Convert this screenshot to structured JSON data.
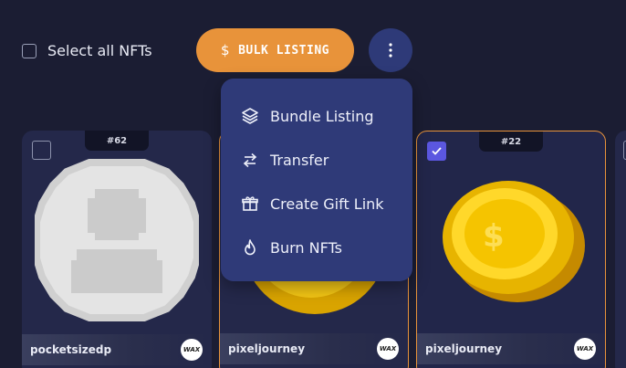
{
  "toolbar": {
    "select_all_label": "Select all NFTs",
    "bulk_listing_label": "BULK LISTING",
    "bulk_listing_icon": "dollar-icon",
    "more_icon": "more-vertical-icon"
  },
  "menu": {
    "items": [
      {
        "label": "Bundle Listing",
        "icon": "layers-icon"
      },
      {
        "label": "Transfer",
        "icon": "transfer-arrows-icon"
      },
      {
        "label": "Create Gift Link",
        "icon": "gift-icon"
      },
      {
        "label": "Burn NFTs",
        "icon": "flame-icon"
      }
    ]
  },
  "cards": [
    {
      "tag": "#62",
      "owner": "pocketsizedp",
      "selected": false,
      "art": "placeholder-avatar-coin"
    },
    {
      "tag": "",
      "owner": "pixeljourney",
      "selected": false,
      "art": "gold-coin"
    },
    {
      "tag": "#22",
      "owner": "pixeljourney",
      "selected": true,
      "art": "gold-coin"
    }
  ],
  "colors": {
    "background": "#1b1d33",
    "accent_orange": "#e8933a",
    "menu_bg": "#2f3a78",
    "checkbox_checked": "#5b57e0",
    "card_bg": "#24284a"
  },
  "chain_badge": "WAX"
}
